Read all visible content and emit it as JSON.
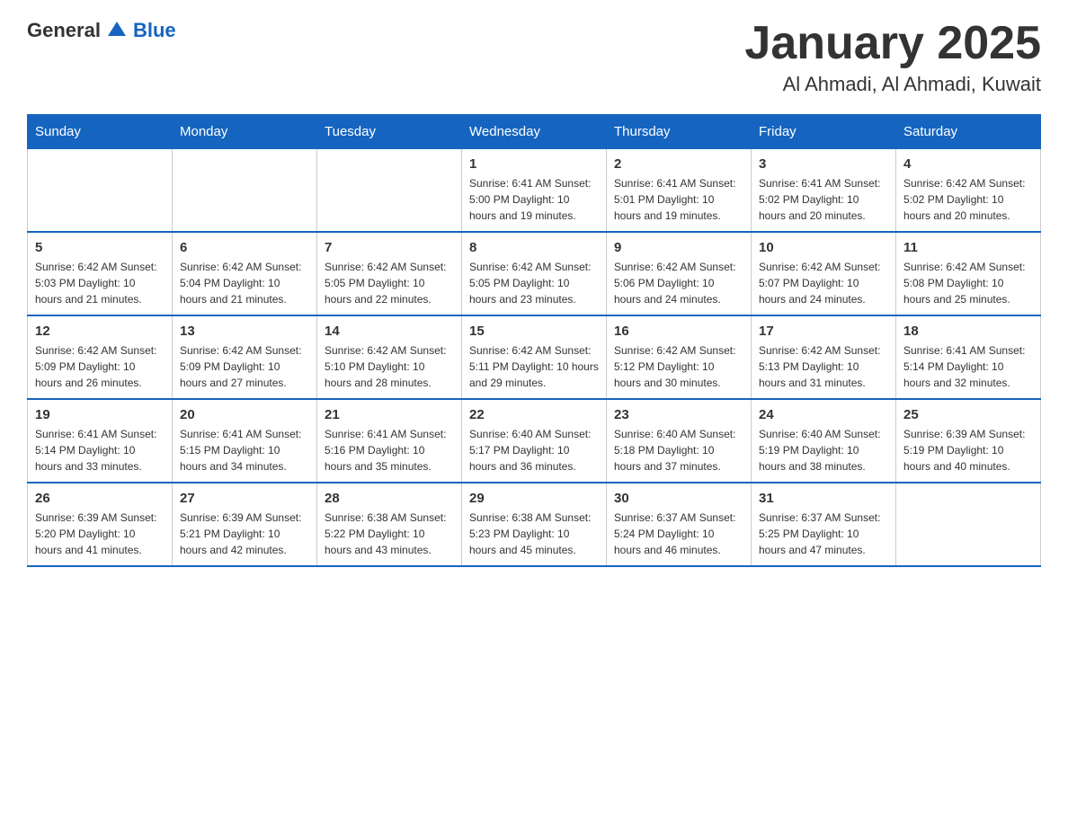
{
  "header": {
    "logo_general": "General",
    "logo_blue": "Blue",
    "month_title": "January 2025",
    "location": "Al Ahmadi, Al Ahmadi, Kuwait"
  },
  "weekdays": [
    "Sunday",
    "Monday",
    "Tuesday",
    "Wednesday",
    "Thursday",
    "Friday",
    "Saturday"
  ],
  "weeks": [
    {
      "days": [
        {
          "number": "",
          "info": ""
        },
        {
          "number": "",
          "info": ""
        },
        {
          "number": "",
          "info": ""
        },
        {
          "number": "1",
          "info": "Sunrise: 6:41 AM\nSunset: 5:00 PM\nDaylight: 10 hours and 19 minutes."
        },
        {
          "number": "2",
          "info": "Sunrise: 6:41 AM\nSunset: 5:01 PM\nDaylight: 10 hours and 19 minutes."
        },
        {
          "number": "3",
          "info": "Sunrise: 6:41 AM\nSunset: 5:02 PM\nDaylight: 10 hours and 20 minutes."
        },
        {
          "number": "4",
          "info": "Sunrise: 6:42 AM\nSunset: 5:02 PM\nDaylight: 10 hours and 20 minutes."
        }
      ]
    },
    {
      "days": [
        {
          "number": "5",
          "info": "Sunrise: 6:42 AM\nSunset: 5:03 PM\nDaylight: 10 hours and 21 minutes."
        },
        {
          "number": "6",
          "info": "Sunrise: 6:42 AM\nSunset: 5:04 PM\nDaylight: 10 hours and 21 minutes."
        },
        {
          "number": "7",
          "info": "Sunrise: 6:42 AM\nSunset: 5:05 PM\nDaylight: 10 hours and 22 minutes."
        },
        {
          "number": "8",
          "info": "Sunrise: 6:42 AM\nSunset: 5:05 PM\nDaylight: 10 hours and 23 minutes."
        },
        {
          "number": "9",
          "info": "Sunrise: 6:42 AM\nSunset: 5:06 PM\nDaylight: 10 hours and 24 minutes."
        },
        {
          "number": "10",
          "info": "Sunrise: 6:42 AM\nSunset: 5:07 PM\nDaylight: 10 hours and 24 minutes."
        },
        {
          "number": "11",
          "info": "Sunrise: 6:42 AM\nSunset: 5:08 PM\nDaylight: 10 hours and 25 minutes."
        }
      ]
    },
    {
      "days": [
        {
          "number": "12",
          "info": "Sunrise: 6:42 AM\nSunset: 5:09 PM\nDaylight: 10 hours and 26 minutes."
        },
        {
          "number": "13",
          "info": "Sunrise: 6:42 AM\nSunset: 5:09 PM\nDaylight: 10 hours and 27 minutes."
        },
        {
          "number": "14",
          "info": "Sunrise: 6:42 AM\nSunset: 5:10 PM\nDaylight: 10 hours and 28 minutes."
        },
        {
          "number": "15",
          "info": "Sunrise: 6:42 AM\nSunset: 5:11 PM\nDaylight: 10 hours and 29 minutes."
        },
        {
          "number": "16",
          "info": "Sunrise: 6:42 AM\nSunset: 5:12 PM\nDaylight: 10 hours and 30 minutes."
        },
        {
          "number": "17",
          "info": "Sunrise: 6:42 AM\nSunset: 5:13 PM\nDaylight: 10 hours and 31 minutes."
        },
        {
          "number": "18",
          "info": "Sunrise: 6:41 AM\nSunset: 5:14 PM\nDaylight: 10 hours and 32 minutes."
        }
      ]
    },
    {
      "days": [
        {
          "number": "19",
          "info": "Sunrise: 6:41 AM\nSunset: 5:14 PM\nDaylight: 10 hours and 33 minutes."
        },
        {
          "number": "20",
          "info": "Sunrise: 6:41 AM\nSunset: 5:15 PM\nDaylight: 10 hours and 34 minutes."
        },
        {
          "number": "21",
          "info": "Sunrise: 6:41 AM\nSunset: 5:16 PM\nDaylight: 10 hours and 35 minutes."
        },
        {
          "number": "22",
          "info": "Sunrise: 6:40 AM\nSunset: 5:17 PM\nDaylight: 10 hours and 36 minutes."
        },
        {
          "number": "23",
          "info": "Sunrise: 6:40 AM\nSunset: 5:18 PM\nDaylight: 10 hours and 37 minutes."
        },
        {
          "number": "24",
          "info": "Sunrise: 6:40 AM\nSunset: 5:19 PM\nDaylight: 10 hours and 38 minutes."
        },
        {
          "number": "25",
          "info": "Sunrise: 6:39 AM\nSunset: 5:19 PM\nDaylight: 10 hours and 40 minutes."
        }
      ]
    },
    {
      "days": [
        {
          "number": "26",
          "info": "Sunrise: 6:39 AM\nSunset: 5:20 PM\nDaylight: 10 hours and 41 minutes."
        },
        {
          "number": "27",
          "info": "Sunrise: 6:39 AM\nSunset: 5:21 PM\nDaylight: 10 hours and 42 minutes."
        },
        {
          "number": "28",
          "info": "Sunrise: 6:38 AM\nSunset: 5:22 PM\nDaylight: 10 hours and 43 minutes."
        },
        {
          "number": "29",
          "info": "Sunrise: 6:38 AM\nSunset: 5:23 PM\nDaylight: 10 hours and 45 minutes."
        },
        {
          "number": "30",
          "info": "Sunrise: 6:37 AM\nSunset: 5:24 PM\nDaylight: 10 hours and 46 minutes."
        },
        {
          "number": "31",
          "info": "Sunrise: 6:37 AM\nSunset: 5:25 PM\nDaylight: 10 hours and 47 minutes."
        },
        {
          "number": "",
          "info": ""
        }
      ]
    }
  ]
}
